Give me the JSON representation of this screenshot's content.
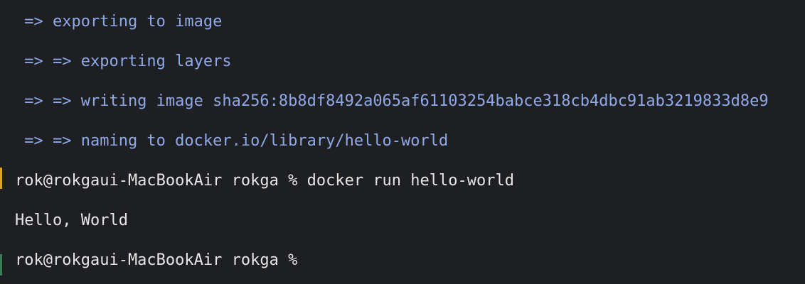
{
  "terminal": {
    "lines": [
      " => exporting to image",
      " => => exporting layers",
      " => => writing image sha256:8b8df8492a065af61103254babce318cb4dbc91ab3219833d8e9",
      " => => naming to docker.io/library/hello-world",
      "rok@rokgaui-MacBookAir rokga % docker run hello-world",
      "Hello, World",
      "rok@rokgaui-MacBookAir rokga %"
    ]
  },
  "colors": {
    "background": "#1e1f22",
    "build_output": "#8fa9e8",
    "plain_text": "#e6e6e6",
    "gutter_warning": "#d9a521",
    "gutter_success": "#3d7a5a"
  }
}
